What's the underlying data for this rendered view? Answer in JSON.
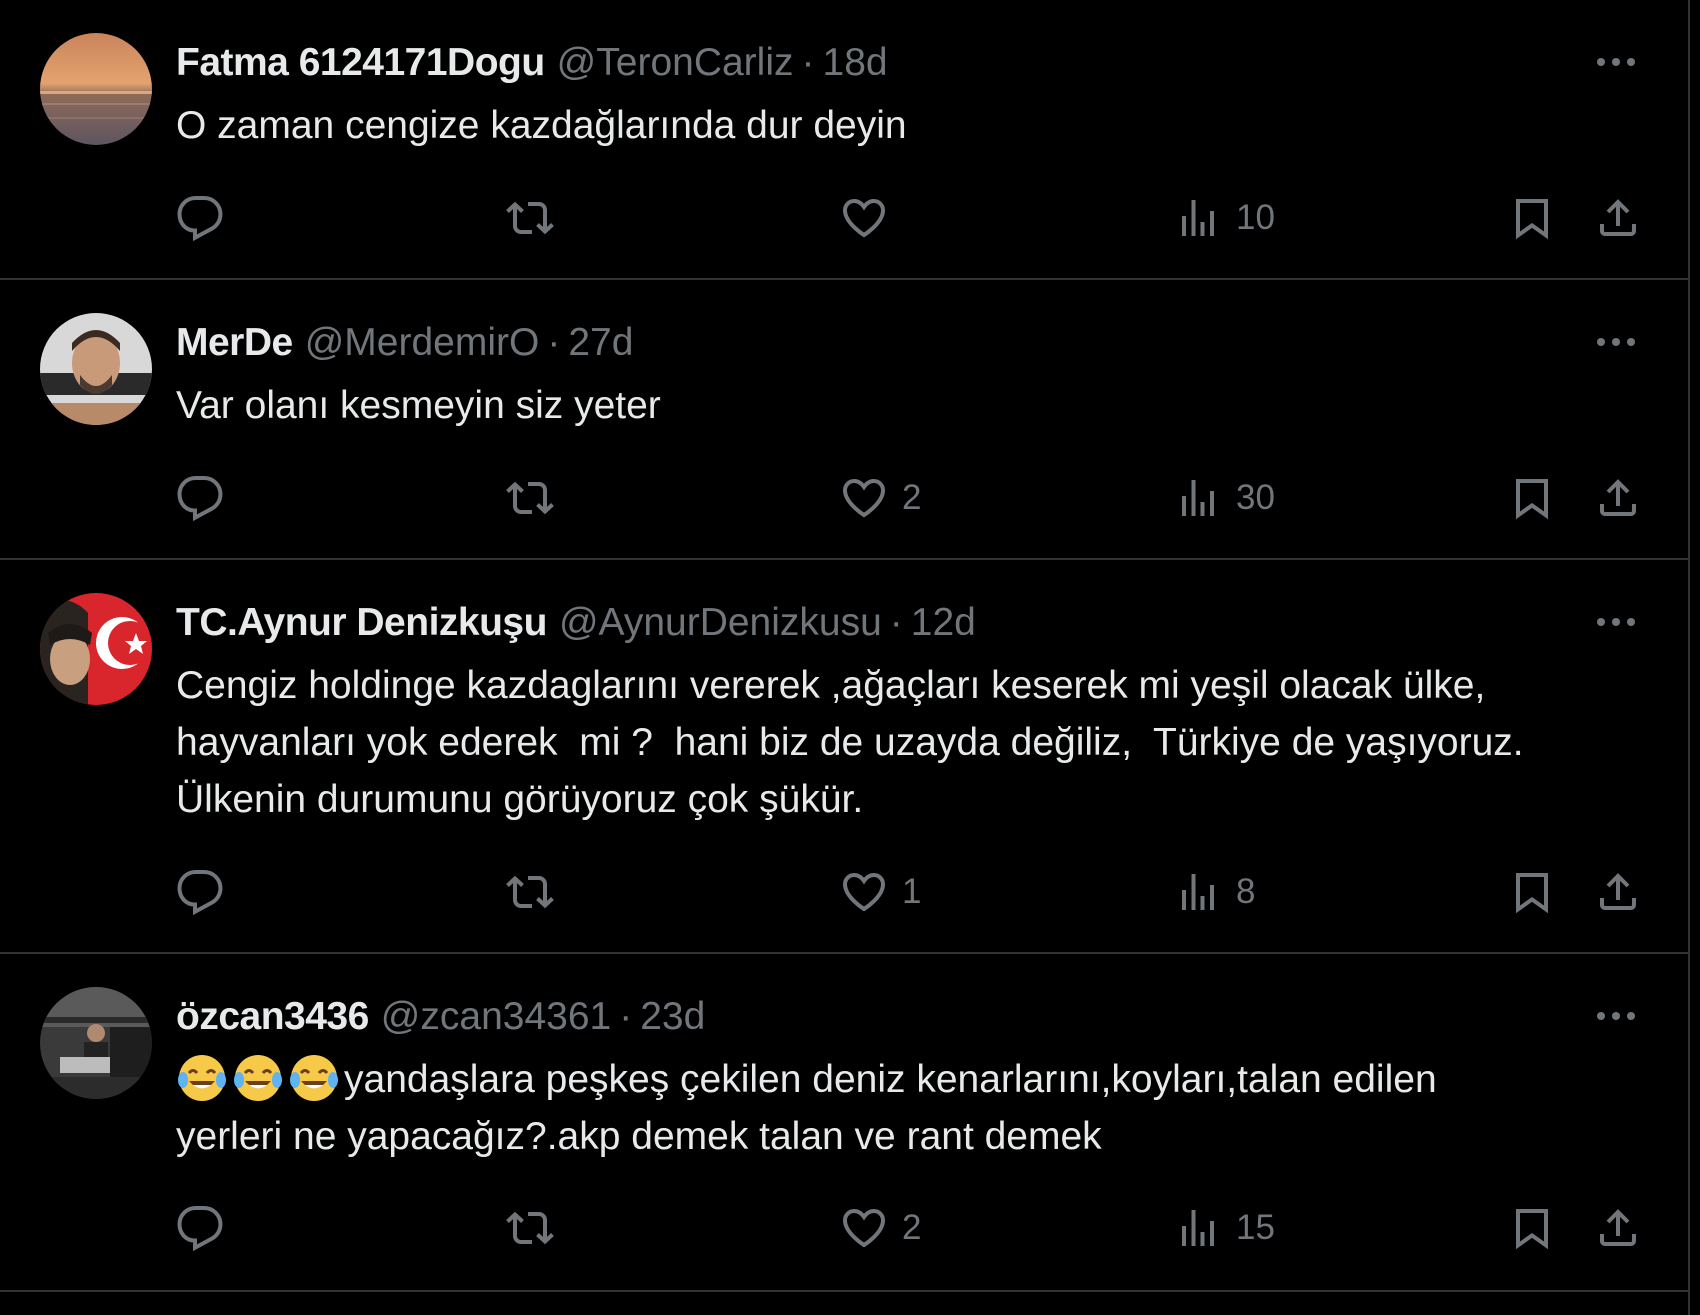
{
  "tweets": [
    {
      "name": "Fatma 6124171Dogu",
      "handle": "@TeronCarliz",
      "separator": "·",
      "time": "18d",
      "text": "O zaman cengize kazdağlarında dur deyin",
      "emoji_prefix": [],
      "replies": "",
      "retweets": "",
      "likes": "",
      "views": "10"
    },
    {
      "name": "MerDe",
      "handle": "@MerdemirO",
      "separator": "·",
      "time": "27d",
      "text": "Var olanı kesmeyin siz yeter",
      "emoji_prefix": [],
      "replies": "",
      "retweets": "",
      "likes": "2",
      "views": "30"
    },
    {
      "name": "TC.Aynur Denizkuşu",
      "handle": "@AynurDenizkusu",
      "separator": "·",
      "time": "12d",
      "text": "Cengiz holdinge kazdaglarını vererek ,ağaçları keserek mi yeşil olacak ülke,\nhayvanları yok ederek  mi ?  hani biz de uzayda değiliz,  Türkiye de yaşıyoruz.\nÜlkenin durumunu görüyoruz çok şükür.",
      "emoji_prefix": [],
      "replies": "",
      "retweets": "",
      "likes": "1",
      "views": "8"
    },
    {
      "name": "özcan3436",
      "handle": "@zcan34361",
      "separator": "·",
      "time": "23d",
      "text": "yandaşlara peşkeş çekilen deniz kenarlarını,koyları,talan edilen\nyerleri ne yapacağız?.akp demek talan ve rant demek",
      "emoji_prefix": [
        "face-with-tears-of-joy",
        "face-with-tears-of-joy",
        "face-with-tears-of-joy"
      ],
      "replies": "",
      "retweets": "",
      "likes": "2",
      "views": "15"
    }
  ],
  "icons": {
    "reply": "reply-icon",
    "retweet": "retweet-icon",
    "like": "heart-icon",
    "views": "views-icon",
    "bookmark": "bookmark-icon",
    "share": "share-icon",
    "more": "more-dots-icon"
  },
  "colors": {
    "background": "#000000",
    "text": "#e7e9ea",
    "secondary": "#71767b",
    "divider": "#2f3336"
  }
}
